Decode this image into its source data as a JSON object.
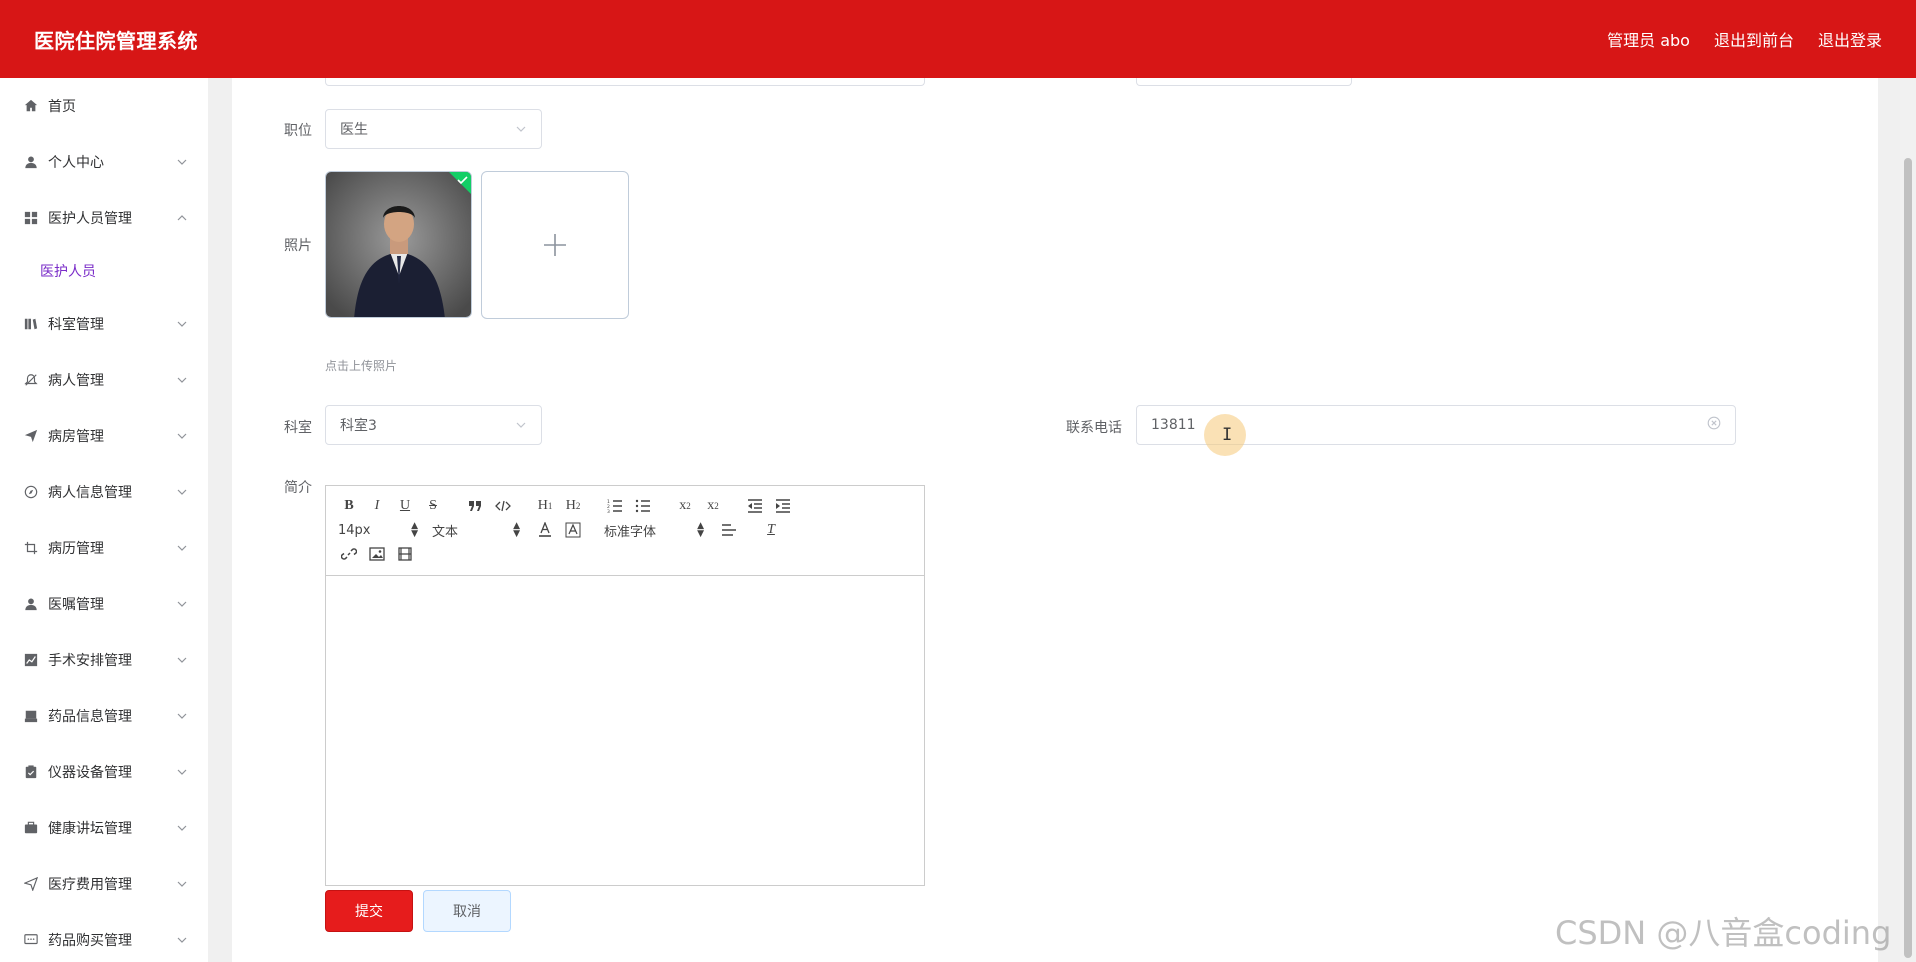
{
  "header": {
    "title": "医院住院管理系统",
    "user": "管理员 abo",
    "to_front": "退出到前台",
    "logout": "退出登录",
    "bg_color": "#d71616"
  },
  "sidebar": {
    "items": [
      {
        "label": "首页",
        "icon": "home-icon",
        "expandable": false
      },
      {
        "label": "个人中心",
        "icon": "user-icon",
        "expandable": true
      },
      {
        "label": "医护人员管理",
        "icon": "grid-icon",
        "expandable": true,
        "expanded": true
      },
      {
        "label": "科室管理",
        "icon": "books-icon",
        "expandable": true
      },
      {
        "label": "病人管理",
        "icon": "bell-off-icon",
        "expandable": true
      },
      {
        "label": "病房管理",
        "icon": "send-icon",
        "expandable": true
      },
      {
        "label": "病人信息管理",
        "icon": "compass-icon",
        "expandable": true
      },
      {
        "label": "病历管理",
        "icon": "crop-icon",
        "expandable": true
      },
      {
        "label": "医嘱管理",
        "icon": "user-icon",
        "expandable": true
      },
      {
        "label": "手术安排管理",
        "icon": "chart-icon",
        "expandable": true
      },
      {
        "label": "药品信息管理",
        "icon": "inbox-icon",
        "expandable": true
      },
      {
        "label": "仪器设备管理",
        "icon": "clipboard-icon",
        "expandable": true
      },
      {
        "label": "健康讲坛管理",
        "icon": "briefcase-icon",
        "expandable": true
      },
      {
        "label": "医疗费用管理",
        "icon": "location-icon",
        "expandable": true
      },
      {
        "label": "药品购买管理",
        "icon": "message-icon",
        "expandable": true
      }
    ],
    "sub_item": "医护人员",
    "active_color": "#7a2cc8"
  },
  "form": {
    "position": {
      "label": "职位",
      "value": "医生"
    },
    "photo": {
      "label": "照片",
      "hint": "点击上传照片"
    },
    "department": {
      "label": "科室",
      "value": "科室3"
    },
    "phone": {
      "label": "联系电话",
      "value": "13811"
    },
    "intro": {
      "label": "简介"
    },
    "submit": "提交",
    "cancel": "取消"
  },
  "editor": {
    "font_size": "14px",
    "block_type": "文本",
    "font_family": "标准字体",
    "bold": "B",
    "italic": "I",
    "underline": "U",
    "strike": "S",
    "h1": "H",
    "h1_sub": "1",
    "h2": "H",
    "h2_sub": "2",
    "sub_x": "x",
    "sub_mark": "2",
    "sup_x": "x",
    "sup_mark": "2",
    "clean": "T"
  },
  "watermark": "CSDN @八音盒coding"
}
